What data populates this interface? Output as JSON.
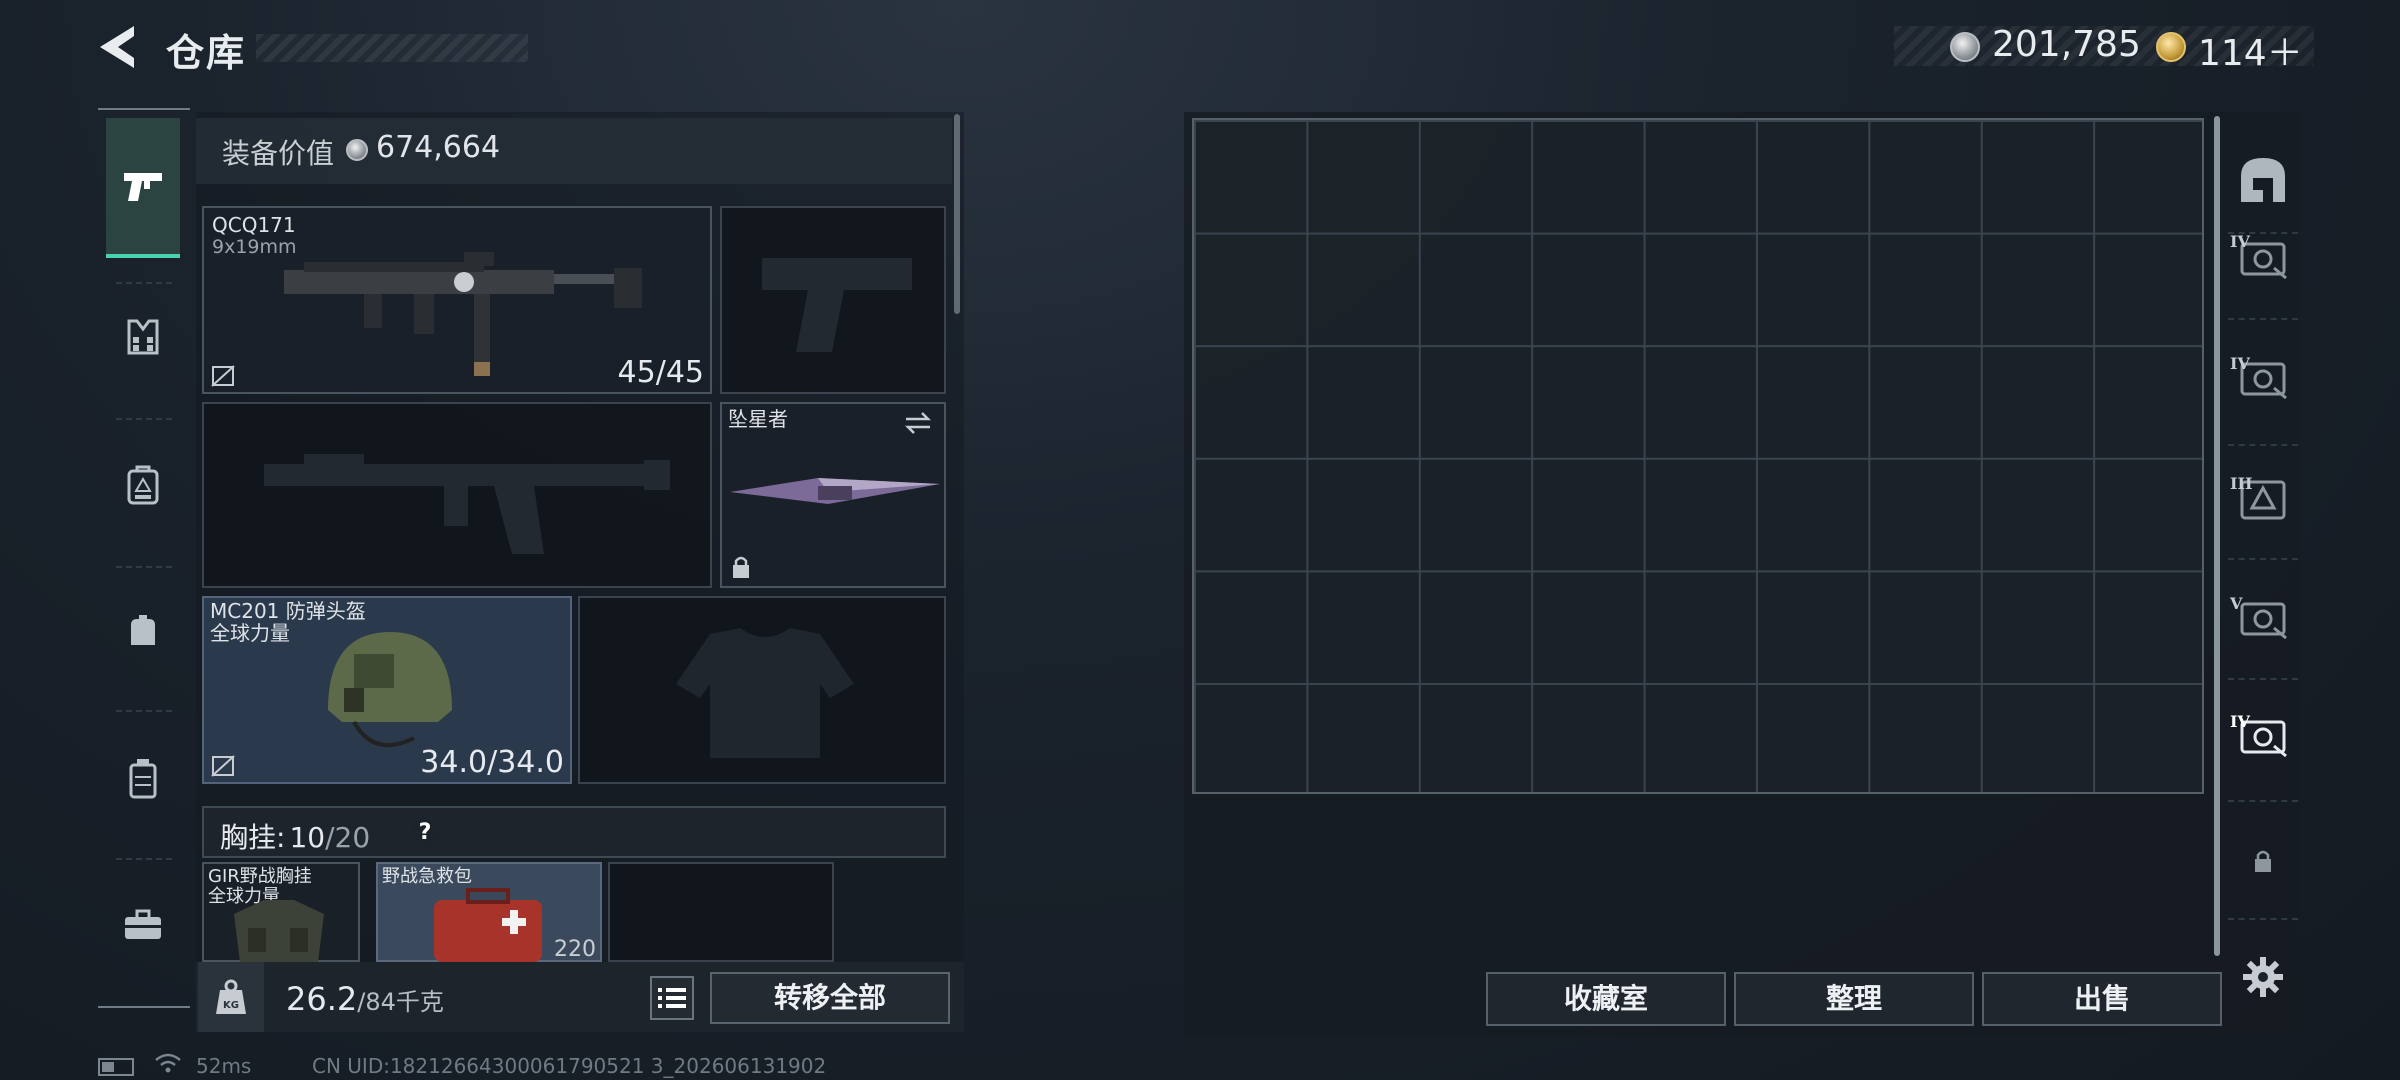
{
  "header": {
    "title": "仓库",
    "silver_amount": "201,785",
    "gold_amount": "114＋"
  },
  "nav": {
    "items": [
      {
        "name": "weapons",
        "icon": "pistol-icon",
        "active": true
      },
      {
        "name": "armor",
        "icon": "vest-icon",
        "active": false
      },
      {
        "name": "backpack-gear",
        "icon": "backpack-icon",
        "active": false
      },
      {
        "name": "pouch",
        "icon": "pouch-icon",
        "active": false
      },
      {
        "name": "container",
        "icon": "container-icon",
        "active": false
      },
      {
        "name": "toolbox",
        "icon": "toolbox-icon",
        "active": false
      }
    ]
  },
  "equipment": {
    "value_label": "装备价值",
    "value": "674,664",
    "primary": {
      "name": "QCQ171",
      "caliber": "9x19mm",
      "ammo": "45/45"
    },
    "melee": {
      "name": "坠星者"
    },
    "helmet": {
      "name": "MC201 防弹头盔",
      "faction": "全球力量",
      "durability": "34.0/34.0"
    },
    "chest": {
      "label": "胸挂:",
      "count": "10",
      "capacity": "/20",
      "help": "?"
    },
    "chest_items": [
      {
        "name": "GIR野战胸挂",
        "faction": "全球力量"
      },
      {
        "name": "野战急救包",
        "amount": "220"
      }
    ]
  },
  "bottom": {
    "weight_value": "26.2",
    "weight_total": "/84千克",
    "weight_icon_text": "KG",
    "transfer_all": "转移全部"
  },
  "storage": {
    "buttons": {
      "collection": "收藏室",
      "sort": "整理",
      "sell": "出售"
    },
    "tabs": [
      {
        "icon": "home-arch-icon",
        "label": ""
      },
      {
        "icon": "case-iv-icon",
        "label": "IV"
      },
      {
        "icon": "case-iv-icon",
        "label": "IV"
      },
      {
        "icon": "case-iii-icon",
        "label": "III"
      },
      {
        "icon": "case-v-icon",
        "label": "V"
      },
      {
        "icon": "case-iv-icon",
        "label": "IV"
      },
      {
        "icon": "lock-icon",
        "label": ""
      }
    ]
  },
  "footer": {
    "ping": "52ms",
    "uid": "CN UID:18212664300061790521 3_202606131902"
  }
}
